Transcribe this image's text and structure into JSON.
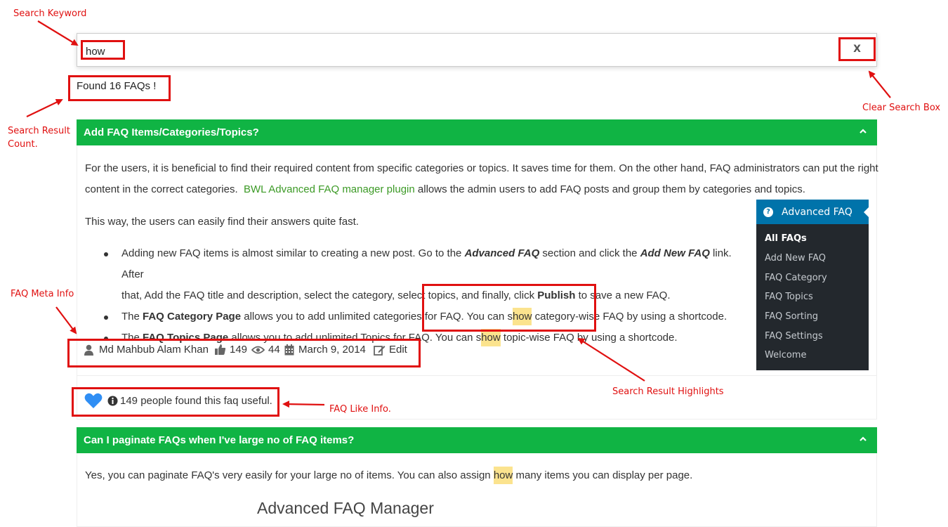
{
  "annotations": {
    "search_keyword": "Search Keyword",
    "clear_search_box": "Clear Search Box",
    "search_result_count": [
      "Search Result",
      "Count."
    ],
    "faq_meta_info": "FAQ Meta Info",
    "search_result_highlights": "Search Result Highlights",
    "faq_like_info": "FAQ Like Info."
  },
  "search": {
    "value": "how",
    "clear_label": "X"
  },
  "result_count": "Found 16 FAQs !",
  "faq1": {
    "title": "Add FAQ Items/Categories/Topics?",
    "p1_line1": "For the users, it is beneficial to find their required content from specific categories or topics. It saves time for them. On the other hand, FAQ administrators can put the right",
    "p1_line2_a": "content in the correct categories.",
    "p1_link": "BWL Advanced FAQ manager plugin",
    "p1_line2_b": "allows the admin users to add FAQ posts and group them by categories and topics.",
    "p2": "This way, the users can easily find their answers quite fast.",
    "b1_a": "Adding new FAQ items is almost similar to creating a new post. Go to the ",
    "b1_em1": "Advanced FAQ",
    "b1_b": " section and click the ",
    "b1_em2": "Add New FAQ",
    "b1_c": " link. After",
    "b1_line2_a": "that, Add the FAQ title and description, select the category, select topics, and finally, click ",
    "b1_strong": "Publish",
    "b1_line2_b": " to save a new FAQ.",
    "b2_a": "The ",
    "b2_strong": "FAQ Category Page",
    "b2_b": " allows you to add unlimited categories for FAQ. You can s",
    "b2_hl": "how",
    "b2_c": " category-wise FAQ by using a shortcode.",
    "b3_a": "The ",
    "b3_strong": "FAQ Topics Page",
    "b3_b": " allows you to add unlimited Topics for FAQ. You can s",
    "b3_hl": "how",
    "b3_c": " topic-wise FAQ by using a shortcode.",
    "meta": {
      "author": "Md Mahbub Alam Khan",
      "likes": "149",
      "views": "44",
      "date": "March 9, 2014",
      "edit": "Edit"
    },
    "like_text": "149 people found this faq useful."
  },
  "wp_menu": {
    "title": "Advanced FAQ",
    "items": [
      "All FAQs",
      "Add New FAQ",
      "FAQ Category",
      "FAQ Topics",
      "FAQ Sorting",
      "FAQ Settings",
      "Welcome"
    ]
  },
  "faq2": {
    "title": "Can I paginate FAQs when I've large no of FAQ items?",
    "p1_a": "Yes, you can paginate FAQ's very easily for your large no of items. You can also assign ",
    "p1_hl": "how",
    "p1_b": " many items you can display per page.",
    "image_title": "Advanced FAQ Manager"
  },
  "colors": {
    "green": "#10b444",
    "annotation_red": "#e01010",
    "highlight": "#fbe38e",
    "wp_blue": "#0073aa",
    "wp_dark": "#23282d",
    "heart_blue": "#2f8ef4"
  },
  "icons": [
    "user-icon",
    "thumbs-up-icon",
    "eye-icon",
    "calendar-icon",
    "edit-icon",
    "heart-icon",
    "info-icon",
    "chevron-up-icon",
    "question-icon"
  ]
}
